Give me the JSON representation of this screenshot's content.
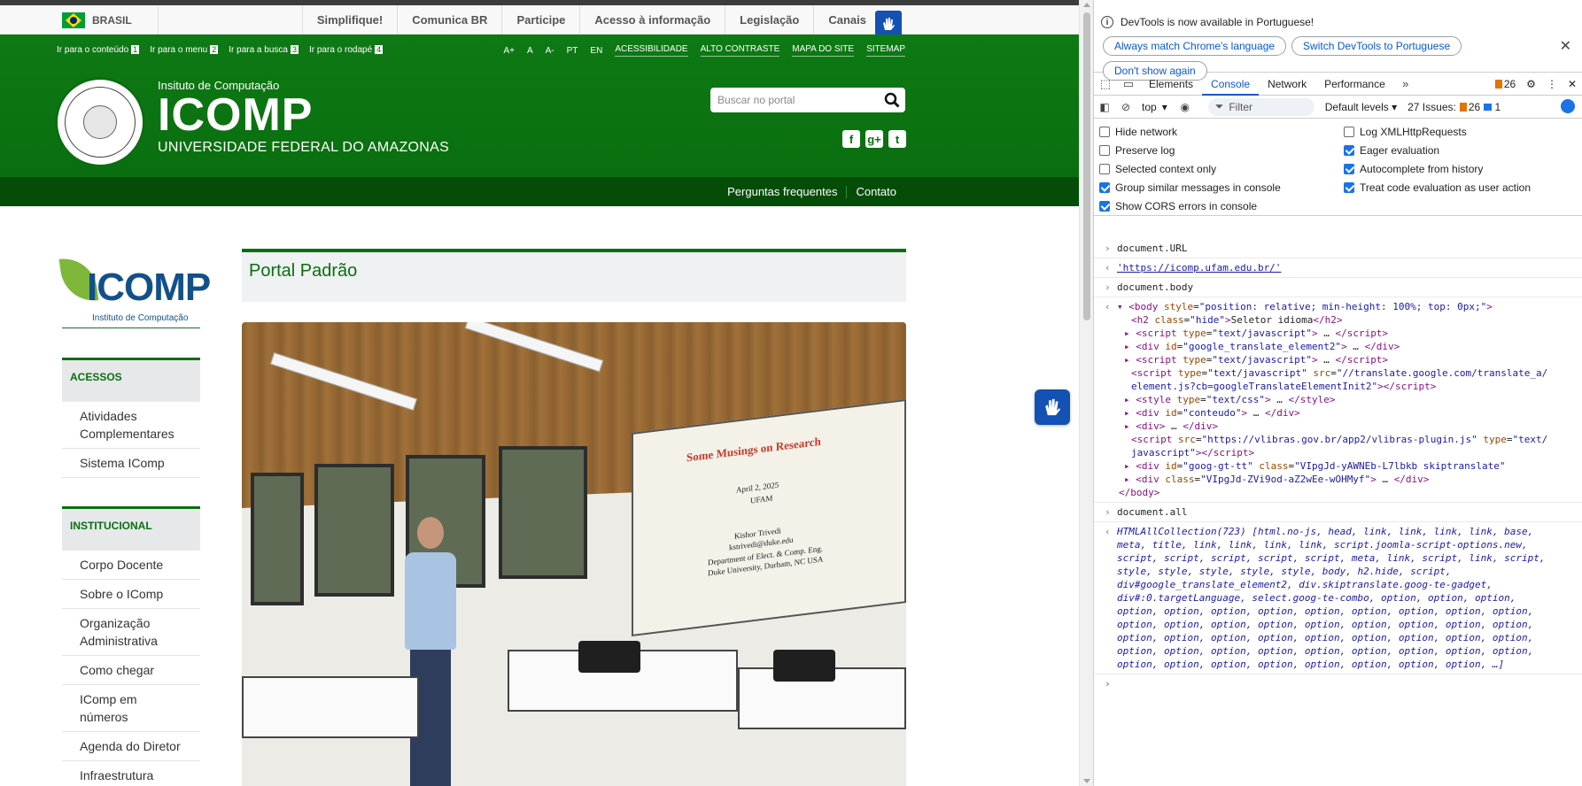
{
  "gov_bar": {
    "country": "BRASIL",
    "links": [
      "Simplifique!",
      "Comunica BR",
      "Participe",
      "Acesso à informação",
      "Legislação",
      "Canais"
    ]
  },
  "skip_links": [
    {
      "label": "Ir para o conteúdo",
      "key": "1"
    },
    {
      "label": "Ir para o menu",
      "key": "2"
    },
    {
      "label": "Ir para a busca",
      "key": "3"
    },
    {
      "label": "Ir para o rodapé",
      "key": "4"
    }
  ],
  "accessibility": {
    "font_sizes": [
      "A+",
      "A",
      "A-"
    ],
    "languages": [
      "PT",
      "EN"
    ],
    "links": [
      "ACESSIBILIDADE",
      "ALTO CONTRASTE",
      "MAPA DO SITE",
      "SITEMAP"
    ]
  },
  "site": {
    "pre_title": "Insituto de Computação",
    "title": "ICOMP",
    "subtitle": "UNIVERSIDADE FEDERAL DO AMAZONAS"
  },
  "search": {
    "placeholder": "Buscar no portal"
  },
  "social": [
    "f",
    "g+",
    "t"
  ],
  "subnav": [
    "Perguntas frequentes",
    "Contato"
  ],
  "sidebar": {
    "logo_text": "ICOMP",
    "logo_tag": "Instituto de Computação",
    "sections": [
      {
        "title": "ACESSOS",
        "items": [
          "Atividades Complementares",
          "Sistema IComp"
        ]
      },
      {
        "title": "INSTITUCIONAL",
        "items": [
          "Corpo Docente",
          "Sobre o IComp",
          "Organização Administrativa",
          "Como chegar",
          "IComp em números",
          "Agenda do Diretor",
          "Infraestrutura"
        ]
      }
    ]
  },
  "content": {
    "heading": "Portal Padrão",
    "slide": {
      "title": "Some Musings on Research",
      "date": "April 2, 2025",
      "place": "UFAM",
      "author": "Kishor Trivedi",
      "email": "kstrivedi@duke.edu",
      "dept": "Department of Elect. & Comp. Eng.",
      "univ": "Duke University, Durham, NC USA"
    }
  },
  "devtools": {
    "notice": {
      "message": "DevTools is now available in Portuguese!",
      "buttons": [
        "Always match Chrome's language",
        "Switch DevTools to Portuguese",
        "Don't show again"
      ]
    },
    "tabs": [
      "Elements",
      "Console",
      "Network",
      "Performance"
    ],
    "active_tab": "Console",
    "warn_count": "26",
    "toolbar": {
      "context": "top",
      "filter_placeholder": "Filter",
      "levels": "Default levels",
      "issues_label": "27 Issues:",
      "issues_warn": "26",
      "issues_info": "1"
    },
    "settings_left": [
      {
        "label": "Hide network",
        "checked": false
      },
      {
        "label": "Preserve log",
        "checked": false
      },
      {
        "label": "Selected context only",
        "checked": false
      },
      {
        "label": "Group similar messages in console",
        "checked": true
      },
      {
        "label": "Show CORS errors in console",
        "checked": true
      }
    ],
    "settings_right": [
      {
        "label": "Log XMLHttpRequests",
        "checked": false
      },
      {
        "label": "Eager evaluation",
        "checked": true
      },
      {
        "label": "Autocomplete from history",
        "checked": true
      },
      {
        "label": "Treat code evaluation as user action",
        "checked": true
      }
    ],
    "console": {
      "cmd1": "document.URL",
      "url_result": "'https://icomp.ufam.edu.br/'",
      "cmd2": "document.body",
      "cmd3": "document.all",
      "all_result_head": "HTMLAllCollection(723)"
    }
  },
  "colors": {
    "header_green": "#0e7a14",
    "subnav_green": "#064c09",
    "devtools_blue": "#0b57d0"
  }
}
